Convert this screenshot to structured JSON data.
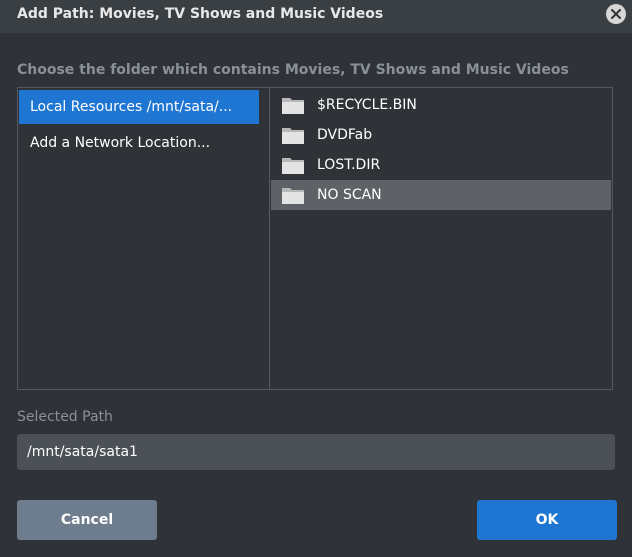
{
  "dialog": {
    "title": "Add Path: Movies, TV Shows and Music Videos",
    "close_icon": "close-icon",
    "prompt": "Choose the folder which contains Movies, TV Shows and Music Videos"
  },
  "locations": [
    {
      "label": "Local Resources /mnt/sata/...",
      "selected": true
    },
    {
      "label": "Add a Network Location...",
      "selected": false
    }
  ],
  "folders": [
    {
      "name": "$RECYCLE.BIN",
      "icon": "folder-icon",
      "selected": false
    },
    {
      "name": "DVDFab",
      "icon": "folder-icon",
      "selected": false
    },
    {
      "name": "LOST.DIR",
      "icon": "folder-icon",
      "selected": false
    },
    {
      "name": "NO SCAN",
      "icon": "folder-icon",
      "selected": true
    }
  ],
  "selected_path": {
    "label": "Selected Path",
    "value": "/mnt/sata/sata1"
  },
  "buttons": {
    "cancel": "Cancel",
    "ok": "OK"
  },
  "colors": {
    "background": "#2f3338",
    "accent": "#1f76d2",
    "selected_row": "#5e6266",
    "cancel_button": "#6e7d8d"
  }
}
